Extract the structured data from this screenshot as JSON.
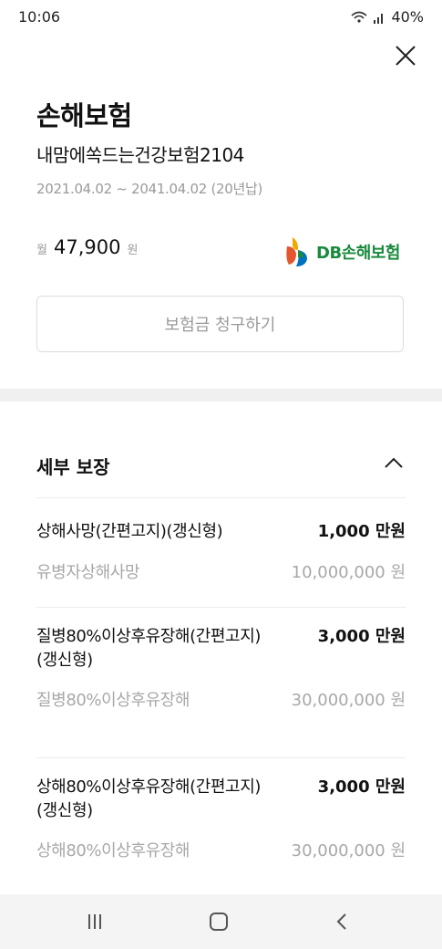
{
  "status_bar": {
    "time": "10:06",
    "battery": "40%"
  },
  "header": {
    "title": "손해보험",
    "product_name": "내맘에쏙드는건강보험2104",
    "period": "2021.04.02 ~ 2041.04.02 (20년납)"
  },
  "premium": {
    "prefix": "월",
    "amount": "47,900",
    "suffix": "원"
  },
  "insurer_logo": {
    "text": "DB손해보험",
    "colors": [
      "#f2a900",
      "#e4572e",
      "#0070c0",
      "#1a8a3e"
    ]
  },
  "claim_button": {
    "label": "보험금 청구하기"
  },
  "coverage": {
    "title": "세부 보장",
    "items": [
      {
        "name": "상해사망(간편고지)(갱신형)",
        "amount": "1,000 만원",
        "sub_name": "유병자상해사망",
        "sub_amount": "10,000,000 원"
      },
      {
        "name": "질병80%이상후유장해(간편고지)(갱신형)",
        "amount": "3,000 만원",
        "sub_name": "질병80%이상후유장해",
        "sub_amount": "30,000,000 원"
      },
      {
        "name": "상해80%이상후유장해(간편고지)(갱신형)",
        "amount": "3,000 만원",
        "sub_name": "상해80%이상후유장해",
        "sub_amount": "30,000,000 원"
      }
    ]
  },
  "nav": {
    "recent_icon": "recent-apps-icon",
    "home_icon": "home-icon",
    "back_icon": "back-icon"
  }
}
